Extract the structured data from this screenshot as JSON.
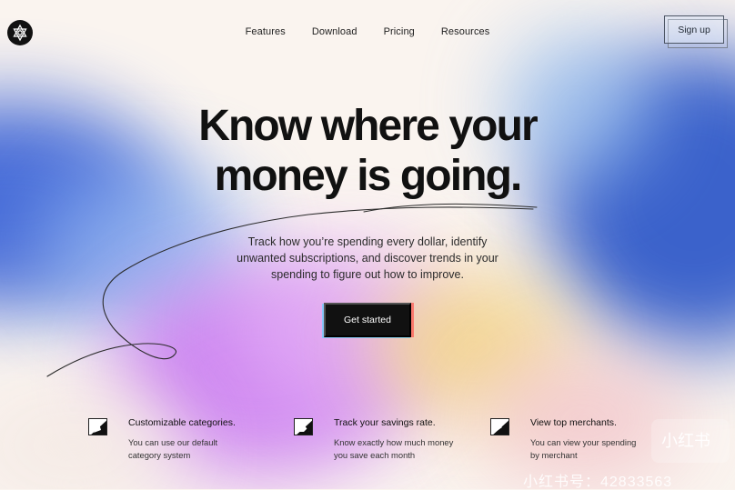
{
  "nav": {
    "items": [
      "Features",
      "Download",
      "Pricing",
      "Resources"
    ],
    "signup_label": "Sign up"
  },
  "hero": {
    "title_lines": [
      "Know where your",
      "money is going."
    ],
    "subtitle_lines": [
      "Track how you’re spending every dollar, identify",
      "unwanted subscriptions, and discover trends in your",
      "spending to figure out how to improve."
    ],
    "cta_label": "Get started"
  },
  "features": [
    {
      "title": "Customizable categories.",
      "desc_lines": [
        "You can use our default",
        "category system"
      ]
    },
    {
      "title": "Track your savings rate.",
      "desc_lines": [
        "Know exactly how much money",
        "you save each month"
      ]
    },
    {
      "title": "View top merchants.",
      "desc_lines": [
        "You can view your spending",
        "by merchant"
      ]
    }
  ],
  "watermark": {
    "badge_text": "小红书",
    "id_text": "小红书号：42833563"
  },
  "colors": {
    "text": "#111111",
    "background": "#FAF4EF",
    "cta": "#111111",
    "accent_blue": "#2B56C8",
    "accent_purple": "#C36CF1",
    "accent_yellow": "#F3D68C"
  },
  "icons": {
    "logo": "logo-icon",
    "feature_1": "category-icon",
    "feature_2": "savings-icon",
    "feature_3": "merchant-icon"
  }
}
